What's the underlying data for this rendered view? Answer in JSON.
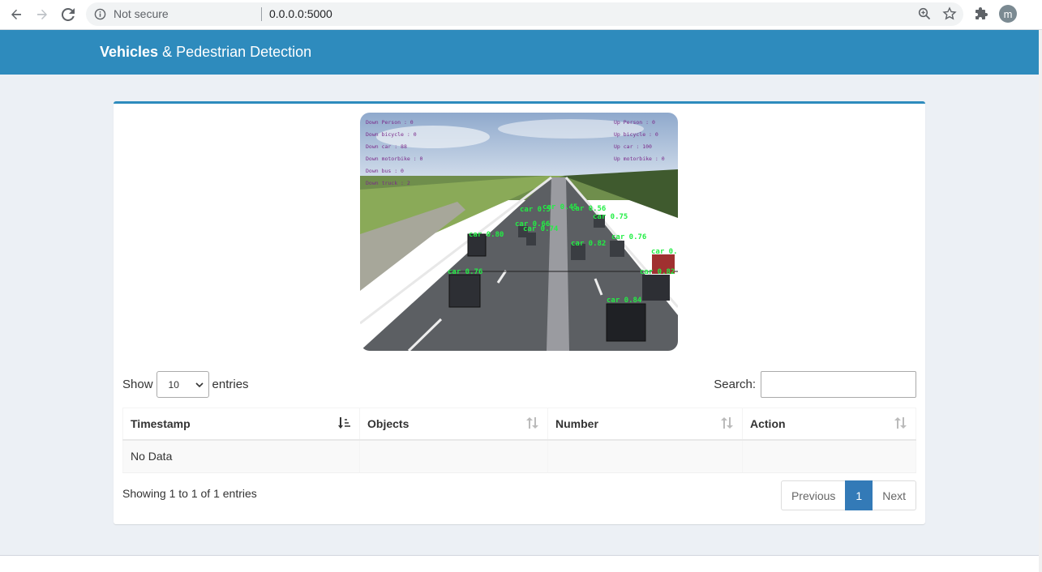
{
  "browser": {
    "secure_label": "Not secure",
    "url": "0.0.0.0:5000",
    "profile_initial": "m"
  },
  "header": {
    "brand_bold": "Vehicles",
    "brand_rest": " & Pedestrian Detection",
    "color": "#2e8bbd"
  },
  "video": {
    "down_counts": [
      "Down Person : 0",
      "Down bicycle : 0",
      "Down car : 88",
      "Down motorbike : 0",
      "Down bus : 0",
      "Down truck : 2"
    ],
    "up_counts": [
      "Up Person : 0",
      "Up bicycle : 0",
      "Up car : 100",
      "Up motorbike : 0"
    ],
    "detections": [
      "car 0.80",
      "car 0.66",
      "car 0.74",
      "car 0.5",
      "car 0.45",
      "car 0.56",
      "car 0.75",
      "car 0.76",
      "car 0.82",
      "car 0.7",
      "car 0.76",
      "car 0.82",
      "car 0.84"
    ]
  },
  "table_controls": {
    "show_label": "Show",
    "length_value": "10",
    "entries_label": "entries",
    "search_label": "Search:"
  },
  "table": {
    "columns": [
      "Timestamp",
      "Objects",
      "Number",
      "Action"
    ],
    "rows": [
      [
        "No Data",
        "",
        "",
        ""
      ]
    ]
  },
  "footer": {
    "info": "Showing 1 to 1 of 1 entries",
    "prev": "Previous",
    "page": "1",
    "next": "Next"
  }
}
